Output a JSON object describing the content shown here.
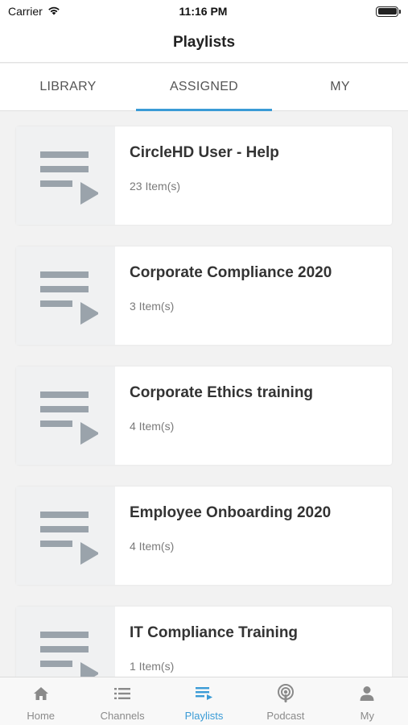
{
  "status_bar": {
    "carrier": "Carrier",
    "time": "11:16 PM"
  },
  "nav": {
    "title": "Playlists"
  },
  "tabs": [
    {
      "label": "LIBRARY",
      "active": false
    },
    {
      "label": "ASSIGNED",
      "active": true
    },
    {
      "label": "MY",
      "active": false
    }
  ],
  "playlists": [
    {
      "title": "CircleHD User - Help",
      "count": "23 Item(s)"
    },
    {
      "title": "Corporate Compliance 2020",
      "count": "3 Item(s)"
    },
    {
      "title": "Corporate Ethics training",
      "count": "4 Item(s)"
    },
    {
      "title": "Employee Onboarding 2020",
      "count": "4 Item(s)"
    },
    {
      "title": "IT Compliance Training",
      "count": "1 Item(s)"
    }
  ],
  "tab_bar": [
    {
      "label": "Home",
      "icon": "home-icon",
      "active": false
    },
    {
      "label": "Channels",
      "icon": "list-icon",
      "active": false
    },
    {
      "label": "Playlists",
      "icon": "playlist-icon",
      "active": true
    },
    {
      "label": "Podcast",
      "icon": "podcast-icon",
      "active": false
    },
    {
      "label": "My",
      "icon": "person-icon",
      "active": false
    }
  ],
  "colors": {
    "accent": "#3a9bd6",
    "thumb_icon": "#9aa3ab",
    "thumb_bg": "#f0f1f2"
  }
}
